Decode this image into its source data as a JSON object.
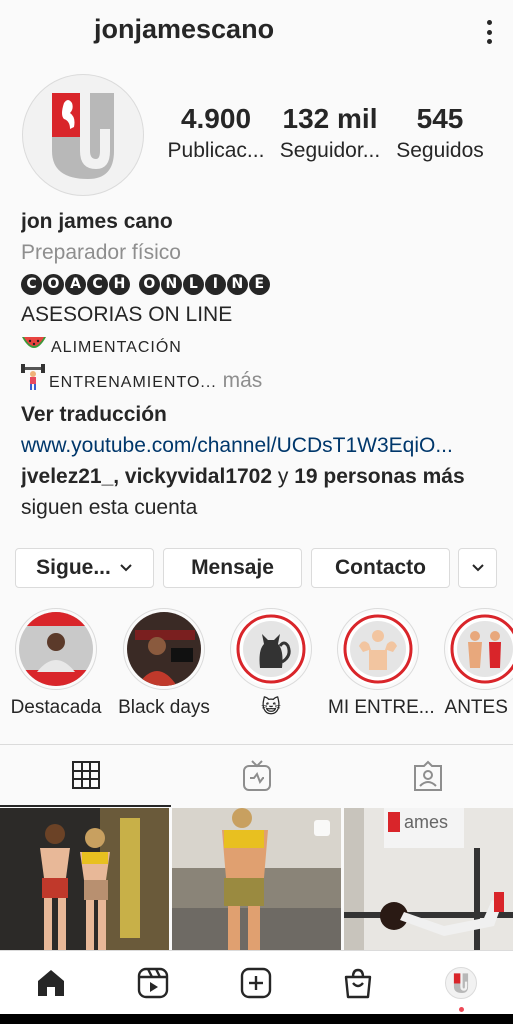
{
  "header": {
    "username": "jonjamescano"
  },
  "stats": [
    {
      "value": "4.900",
      "label": "Publicac..."
    },
    {
      "value": "132 mil",
      "label": "Seguidor..."
    },
    {
      "value": "545",
      "label": "Seguidos"
    }
  ],
  "bio": {
    "name": "jon james cano",
    "category": "Preparador físico",
    "coach_letters": [
      "C",
      "O",
      "A",
      "C",
      "H",
      " ",
      "O",
      "N",
      "L",
      "I",
      "N",
      "E"
    ],
    "line_asesorias": "ASESORIAS ON LINE",
    "line_alimentacion": "ALIMENTACIÓN",
    "line_entrenamiento": "ENTRENAMIENTO",
    "more_ellipsis": "...",
    "more": "más",
    "translate": "Ver traducción",
    "website": "www.youtube.com/channel/UCDsT1W3EqiO...",
    "followed_by_users": "jvelez21_, vickyvidal1702",
    "followed_by_and": "y",
    "followed_by_more": "19 personas más",
    "followed_by_tail": "siguen esta cuenta"
  },
  "actions": {
    "following": "Sigue...",
    "message": "Mensaje",
    "contact": "Contacto"
  },
  "highlights": [
    {
      "label": "Destacada"
    },
    {
      "label": "Black days"
    },
    {
      "label": "😺"
    },
    {
      "label": "MI ENTRE..."
    },
    {
      "label": "ANTES Y"
    }
  ],
  "tabs": [
    "grid-icon",
    "igtv-icon",
    "tagged-icon"
  ],
  "colors": {
    "link": "#00376b",
    "muted": "#8e8e8e",
    "border": "#dbdbdb",
    "notification": "#ed4956",
    "brand_red": "#d9252a"
  },
  "bottom_nav": [
    "home-icon",
    "reels-icon",
    "new-post-icon",
    "shop-icon",
    "profile-avatar"
  ]
}
